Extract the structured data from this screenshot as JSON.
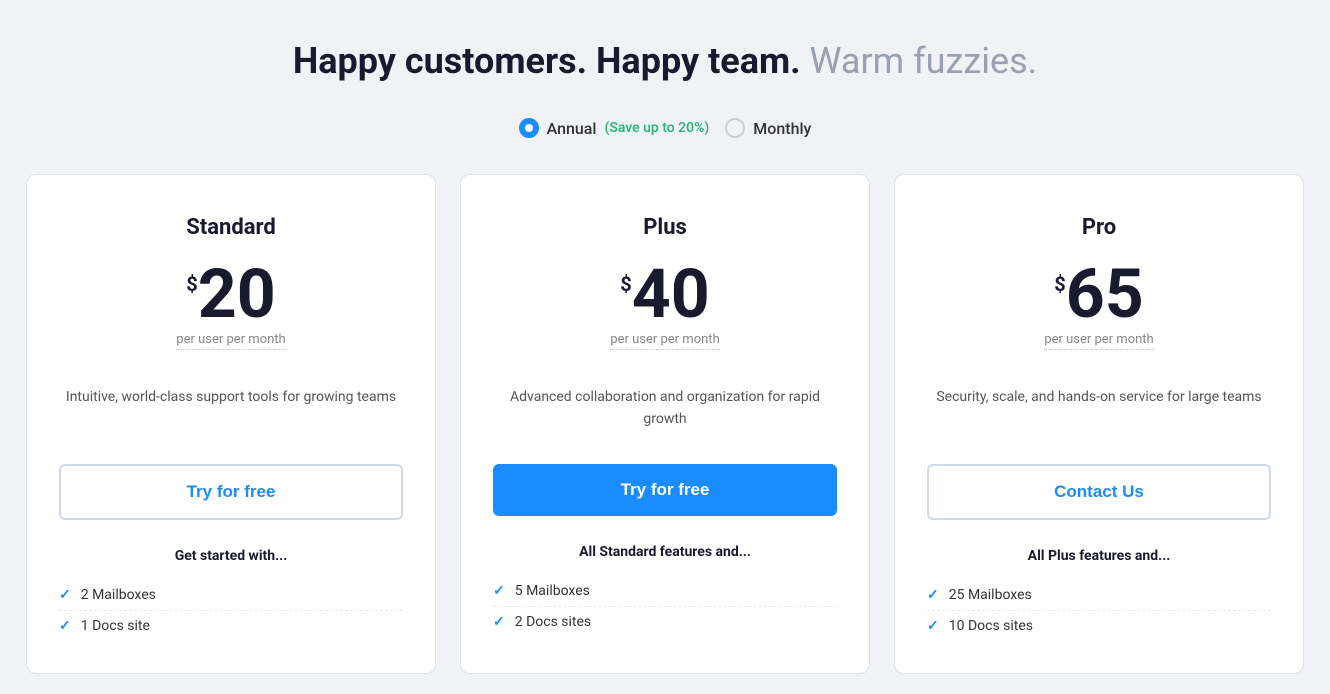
{
  "headline": {
    "part1": "Happy customers. Happy team.",
    "part2": " Warm fuzzies."
  },
  "billing": {
    "annual_label": "Annual",
    "annual_save": "(Save up to 20%)",
    "monthly_label": "Monthly",
    "selected": "annual"
  },
  "plans": [
    {
      "id": "standard",
      "name": "Standard",
      "price": "20",
      "currency": "$",
      "period": "per user per month",
      "description": "Intuitive, world-class support tools for growing teams",
      "cta_label": "Try for free",
      "cta_style": "outline",
      "features_header": "Get started with...",
      "features": [
        "2 Mailboxes",
        "1 Docs site"
      ]
    },
    {
      "id": "plus",
      "name": "Plus",
      "price": "40",
      "currency": "$",
      "period": "per user per month",
      "description": "Advanced collaboration and organization for rapid growth",
      "cta_label": "Try for free",
      "cta_style": "filled",
      "features_header": "All Standard features and...",
      "features": [
        "5 Mailboxes",
        "2 Docs sites"
      ]
    },
    {
      "id": "pro",
      "name": "Pro",
      "price": "65",
      "currency": "$",
      "period": "per user per month",
      "description": "Security, scale, and hands-on service for large teams",
      "cta_label": "Contact Us",
      "cta_style": "outline",
      "features_header": "All Plus features and...",
      "features": [
        "25 Mailboxes",
        "10 Docs sites"
      ]
    }
  ]
}
